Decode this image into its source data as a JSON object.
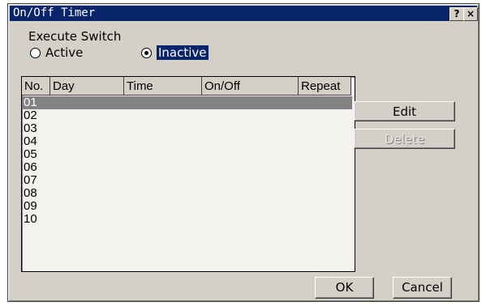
{
  "window": {
    "title": "On/Off Timer",
    "help_label": "?",
    "close_label": "×"
  },
  "execute_switch": {
    "label": "Execute Switch",
    "options": [
      {
        "label": "Active",
        "selected": false
      },
      {
        "label": "Inactive",
        "selected": true
      }
    ]
  },
  "table": {
    "columns": [
      "No.",
      "Day",
      "Time",
      "On/Off",
      "Repeat"
    ],
    "rows": [
      "01",
      "02",
      "03",
      "04",
      "05",
      "06",
      "07",
      "08",
      "09",
      "10"
    ],
    "selected_row": "01"
  },
  "buttons": {
    "edit": "Edit",
    "delete": "Delete",
    "ok": "OK",
    "cancel": "Cancel"
  },
  "colors": {
    "title_bar": "#08246b",
    "selection": "#828282",
    "face": "#d4d0c8"
  }
}
